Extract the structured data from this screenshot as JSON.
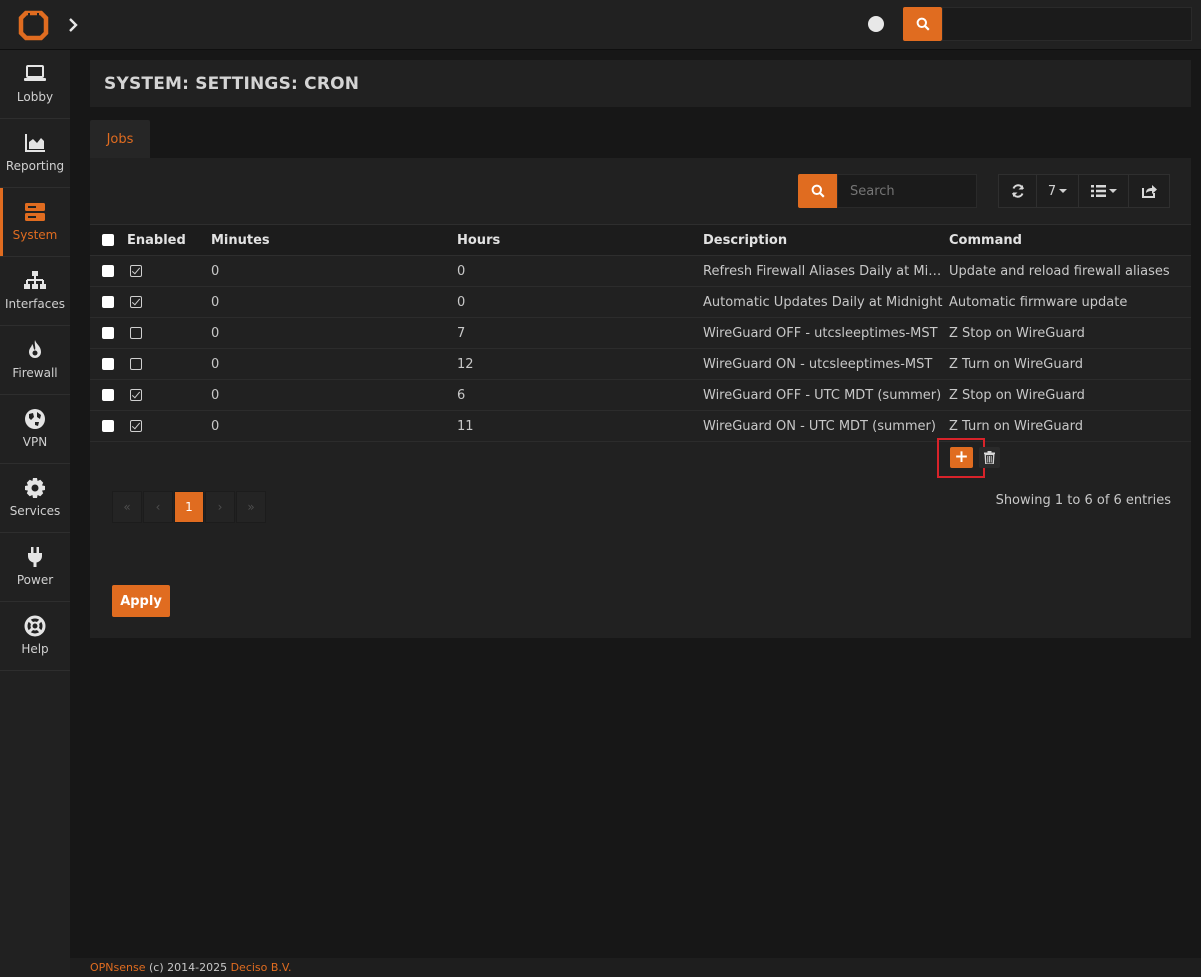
{
  "topbar": {
    "search_placeholder": ""
  },
  "sidebar": {
    "items": [
      {
        "label": "Lobby",
        "icon": "laptop-icon"
      },
      {
        "label": "Reporting",
        "icon": "area-chart-icon"
      },
      {
        "label": "System",
        "icon": "server-icon",
        "active": true
      },
      {
        "label": "Interfaces",
        "icon": "sitemap-icon"
      },
      {
        "label": "Firewall",
        "icon": "fire-icon"
      },
      {
        "label": "VPN",
        "icon": "globe-icon"
      },
      {
        "label": "Services",
        "icon": "gear-icon"
      },
      {
        "label": "Power",
        "icon": "plug-icon"
      },
      {
        "label": "Help",
        "icon": "lifebuoy-icon"
      }
    ]
  },
  "page": {
    "title": "SYSTEM: SETTINGS: CRON",
    "tab": "Jobs"
  },
  "toolbar": {
    "search_placeholder": "Search",
    "page_size": "7"
  },
  "table": {
    "headers": [
      "Enabled",
      "Minutes",
      "Hours",
      "Description",
      "Command"
    ],
    "rows": [
      {
        "enabled": true,
        "minutes": "0",
        "hours": "0",
        "description": "Refresh Firewall Aliases Daily at Midnight",
        "command": "Update and reload firewall aliases"
      },
      {
        "enabled": true,
        "minutes": "0",
        "hours": "0",
        "description": "Automatic Updates Daily at Midnight",
        "command": "Automatic firmware update"
      },
      {
        "enabled": false,
        "minutes": "0",
        "hours": "7",
        "description": "WireGuard OFF - utcsleeptimes-MST",
        "command": "Z Stop on WireGuard"
      },
      {
        "enabled": false,
        "minutes": "0",
        "hours": "12",
        "description": "WireGuard ON - utcsleeptimes-MST",
        "command": "Z Turn on WireGuard"
      },
      {
        "enabled": true,
        "minutes": "0",
        "hours": "6",
        "description": "WireGuard OFF - UTC MDT (summer)",
        "command": "Z Stop on WireGuard"
      },
      {
        "enabled": true,
        "minutes": "0",
        "hours": "11",
        "description": "WireGuard ON - UTC MDT (summer)",
        "command": "Z Turn on WireGuard"
      }
    ]
  },
  "pagination": {
    "first": "«",
    "prev": "‹",
    "current": "1",
    "next": "›",
    "last": "»",
    "info": "Showing 1 to 6 of 6 entries"
  },
  "actions": {
    "add": "+",
    "apply": "Apply"
  },
  "footer": {
    "product": "OPNsense",
    "copyright": " (c) 2014-2025 ",
    "company": "Deciso B.V."
  },
  "colors": {
    "accent": "#e06c20",
    "highlight": "#d8232a"
  }
}
